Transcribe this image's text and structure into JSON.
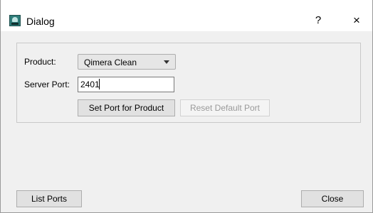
{
  "window": {
    "title": "Dialog",
    "help_label": "?",
    "close_label": "×"
  },
  "form": {
    "product_label": "Product:",
    "product_value": "Qimera Clean",
    "server_port_label": "Server Port:",
    "server_port_value": "2401"
  },
  "buttons": {
    "set_port": "Set Port for Product",
    "reset_default": "Reset Default Port",
    "list_ports": "List Ports",
    "close": "Close"
  },
  "colors": {
    "title_bar": "#ffffff",
    "dialog_background": "#f0f0f0",
    "button_face": "#e1e1e1",
    "disabled_text": "#9a9a9a",
    "icon_accent": "#2f7d7a"
  },
  "icons": {
    "app": "application-icon",
    "dropdown": "chevron-down-icon"
  }
}
